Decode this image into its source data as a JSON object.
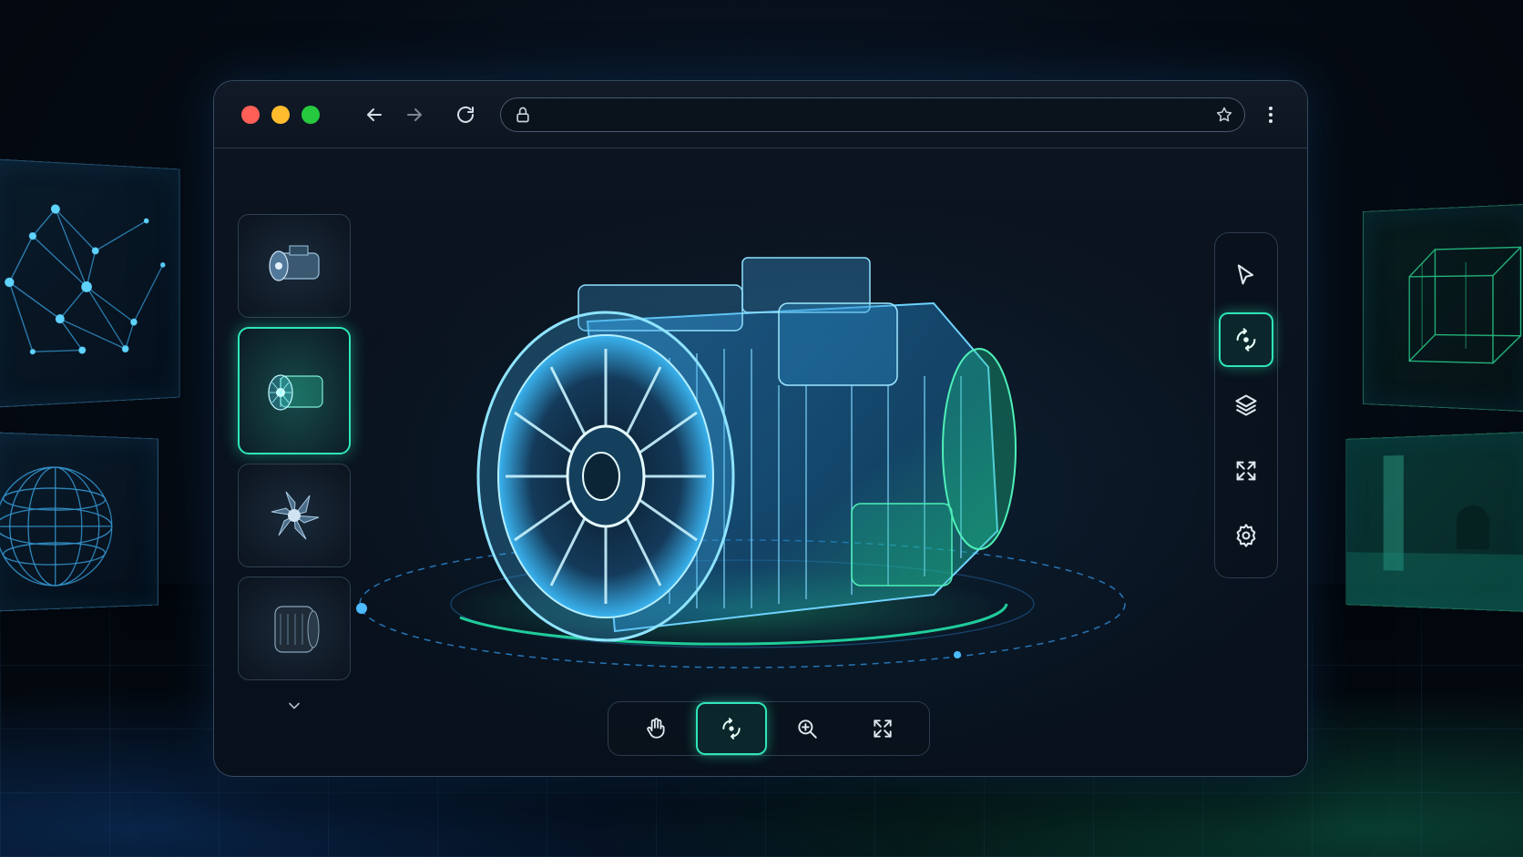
{
  "browser": {
    "traffic_lights": {
      "close": "#ff5f56",
      "minimize": "#ffbd2e",
      "maximize": "#27c93f"
    },
    "address": {
      "value": "",
      "placeholder": ""
    }
  },
  "thumbnails": [
    {
      "name": "engine-front-view",
      "active": false
    },
    {
      "name": "engine-transparent-view",
      "active": true
    },
    {
      "name": "turbine-fan",
      "active": false
    },
    {
      "name": "housing-part",
      "active": false
    }
  ],
  "right_toolbar": [
    {
      "icon": "cursor-icon",
      "active": false
    },
    {
      "icon": "rotate-icon",
      "active": true
    },
    {
      "icon": "layers-icon",
      "active": false
    },
    {
      "icon": "expand-icon",
      "active": false
    },
    {
      "icon": "gear-icon",
      "active": false
    }
  ],
  "bottom_toolbar": [
    {
      "icon": "hand-icon",
      "active": false
    },
    {
      "icon": "rotate-icon",
      "active": true
    },
    {
      "icon": "zoom-in-icon",
      "active": false
    },
    {
      "icon": "fit-screen-icon",
      "active": false
    }
  ],
  "colors": {
    "accent": "#2ee6b6",
    "hologram_blue": "#3fb3ff",
    "hologram_green": "#2ee69a"
  }
}
